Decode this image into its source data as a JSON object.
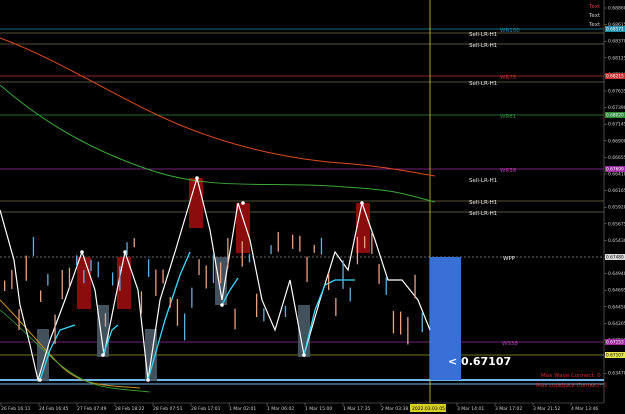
{
  "legend": [
    {
      "text": "Text",
      "color": "#d23b3b"
    },
    {
      "text": "Text",
      "color": "#c8c8c8"
    },
    {
      "text": "Text",
      "color": "#c8c8c8"
    }
  ],
  "line_labels": {
    "wr100": "WR100",
    "sell1": "Sell-LR-H1",
    "sell2": "Sell-LR-H1",
    "wr75": "WR75",
    "wr61": "WR61",
    "wr38": "WR38",
    "sell3": "Sell-LR-H1",
    "sell4": "Sell-LR-H1",
    "sell5": "Sell-LR-H1",
    "wpp": "WPP",
    "ws38": "WS38"
  },
  "price_display": "< 0.67107",
  "info": {
    "max_wave": "Max Wave Connect: 0",
    "max_lookback": "Max Lookback Connect: 0"
  },
  "price_axis": [
    "0.68860",
    "0.68615",
    "0.68370",
    "0.68125",
    "0.67880",
    "0.67635",
    "0.67390",
    "0.67145",
    "0.66900",
    "0.66655",
    "0.66410",
    "0.66165",
    "0.65920",
    "0.65675",
    "0.65430",
    "0.65185",
    "0.64940",
    "0.64695",
    "0.64450",
    "0.64205",
    "0.63960",
    "0.63715",
    "0.63470"
  ],
  "price_tags": [
    {
      "text": "0.68571",
      "color": "#1f8fa8"
    },
    {
      "text": "0.68215",
      "color": "#c23030"
    },
    {
      "text": "0.68020",
      "color": "#2e8b3a"
    },
    {
      "text": "0.67699",
      "color": "#9b2aa0"
    },
    {
      "text": "0.67480",
      "color": "#dcdcdc"
    },
    {
      "text": "0.67153",
      "color": "#9b2aa0"
    },
    {
      "text": "0.67107",
      "color": "#e8e850"
    }
  ],
  "time_axis": [
    "26 Feb 16:11",
    "24 Feb 16:45",
    "27 Feb 07:49",
    "28 Feb 18:22",
    "28 Feb 07:51",
    "28 Feb 17:01",
    "1 Mar 02:01",
    "1 Mar 06:02",
    "1 Mar 15:00",
    "1 Mar 17:35",
    "2 Mar 03:38",
    "2 Mar 21:25",
    "3 Mar 14:01",
    "3 Mar 17:02",
    "3 Mar 21:52",
    "4 Mar 13:46"
  ],
  "time_tag": "2022.03.03 05:00"
}
